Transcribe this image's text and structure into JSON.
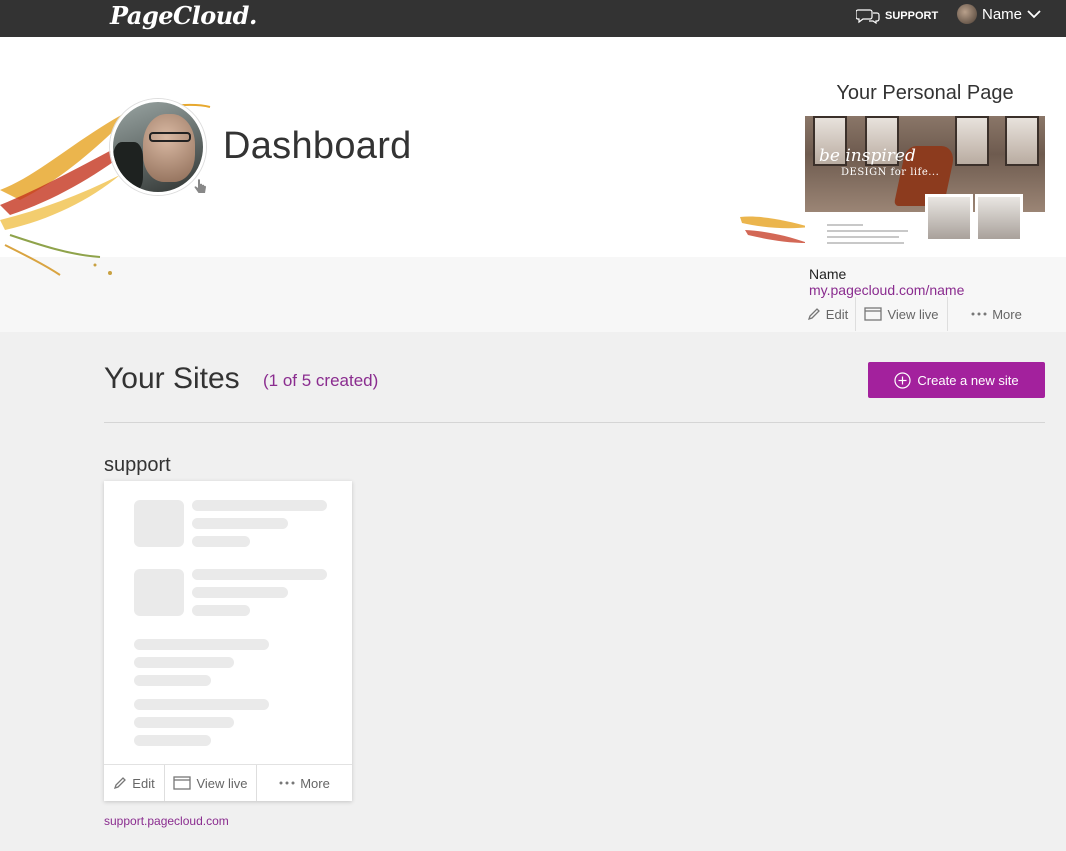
{
  "topbar": {
    "logo": "PageCloud.",
    "support_label": "SUPPORT",
    "user_name": "Name"
  },
  "header": {
    "title": "Dashboard"
  },
  "personal_page": {
    "heading": "Your Personal Page",
    "preview_tagline_1": "be inspired",
    "preview_tagline_2": "DESIGN for life...",
    "name": "Name",
    "url": "my.pagecloud.com/name",
    "actions": {
      "edit": "Edit",
      "view_live": "View live",
      "more": "More"
    }
  },
  "sites": {
    "title": "Your Sites",
    "count": "(1 of 5 created)",
    "create_label": "Create a new site",
    "items": [
      {
        "name": "support",
        "url": "support.pagecloud.com",
        "actions": {
          "edit": "Edit",
          "view_live": "View live",
          "more": "More"
        }
      }
    ]
  },
  "colors": {
    "topbar": "#333333",
    "accent": "#a3219d",
    "link": "#8a2c8f",
    "background": "#f0f0f0"
  }
}
